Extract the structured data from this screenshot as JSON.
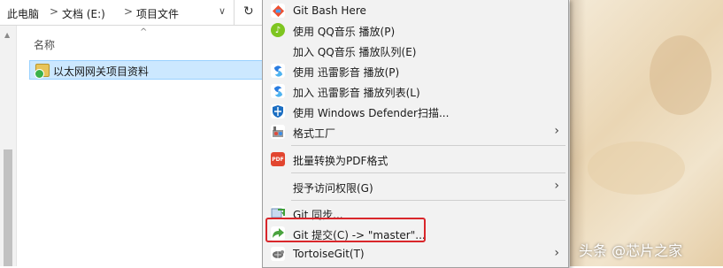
{
  "address": {
    "crumbs": [
      "此电脑",
      "文档 (E:)",
      "项目文件"
    ],
    "separator": ">",
    "dropdown": "∨",
    "refresh": "↻"
  },
  "file_list": {
    "column_name": "名称",
    "sort_indicator": "^",
    "rows": [
      {
        "label": "以太网网关项目资料",
        "icon": "folder-icon",
        "status": "git-clean-badge"
      }
    ]
  },
  "context_menu": {
    "items": [
      {
        "label": "Git Bash Here",
        "icon": "git-bash-icon",
        "color": "#2f8ef0"
      },
      {
        "label": "使用 QQ音乐 播放(P)",
        "icon": "qq-music-icon",
        "color": "#7ec520"
      },
      {
        "label": "加入 QQ音乐 播放队列(E)",
        "icon": "",
        "color": ""
      },
      {
        "label": "使用 迅雷影音 播放(P)",
        "icon": "xunlei-icon",
        "color": "#2a7de1"
      },
      {
        "label": "加入 迅雷影音 播放列表(L)",
        "icon": "xunlei-icon",
        "color": "#2a7de1"
      },
      {
        "label": "使用 Windows Defender扫描...",
        "icon": "defender-icon",
        "color": "#1b6ec2"
      },
      {
        "label": "格式工厂",
        "icon": "format-factory-icon",
        "color": "#8a8a8a",
        "submenu": "›"
      },
      {
        "label": "批量转换为PDF格式",
        "icon": "pdf-icon",
        "color": "#e2452f"
      },
      {
        "label": "授予访问权限(G)",
        "icon": "",
        "color": "",
        "submenu": "›"
      },
      {
        "label": "Git 同步...",
        "icon": "git-sync-icon",
        "color": "#4aa33e"
      },
      {
        "label": "Git 提交(C) -> \"master\"...",
        "icon": "git-commit-icon",
        "color": "#4aa33e"
      },
      {
        "label": "TortoiseGit(T)",
        "icon": "tortoisegit-icon",
        "color": "#6e6e6e",
        "submenu": "›"
      }
    ],
    "highlight_color": "#d9262b"
  },
  "watermark": "头条 @芯片之家"
}
